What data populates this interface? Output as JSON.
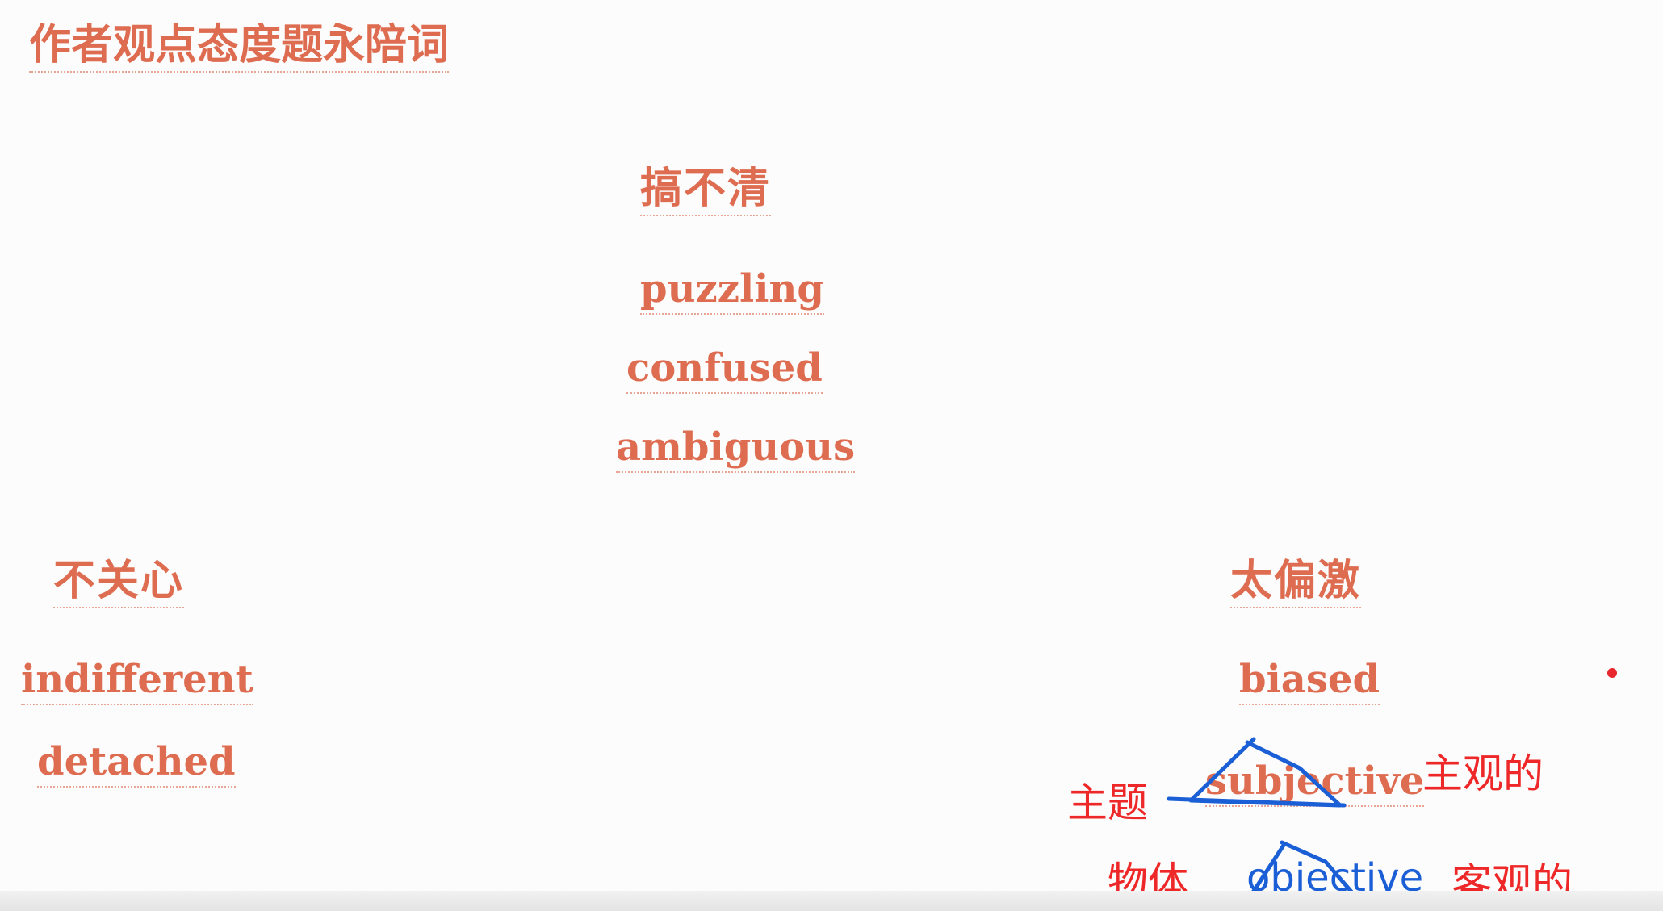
{
  "slide": {
    "title": "作者观点态度题永陪词",
    "groups": {
      "puzzled": {
        "heading": "搞不清",
        "words": [
          "puzzling",
          "confused",
          "ambiguous"
        ]
      },
      "indifferent": {
        "heading": "不关心",
        "words": [
          "indifferent",
          "detached"
        ]
      },
      "biased": {
        "heading": "太偏激",
        "words": [
          "biased",
          "subjective"
        ]
      }
    }
  },
  "handwriting": {
    "subject_cn": "主题",
    "subjective_cn": "主观的",
    "object_cn": "物体",
    "objective_en": "objective",
    "objective_cn": "客观的"
  },
  "colors": {
    "slide_text": "#de6c50",
    "red_pen": "#ee2828",
    "blue_pen": "#1a5fd6"
  }
}
